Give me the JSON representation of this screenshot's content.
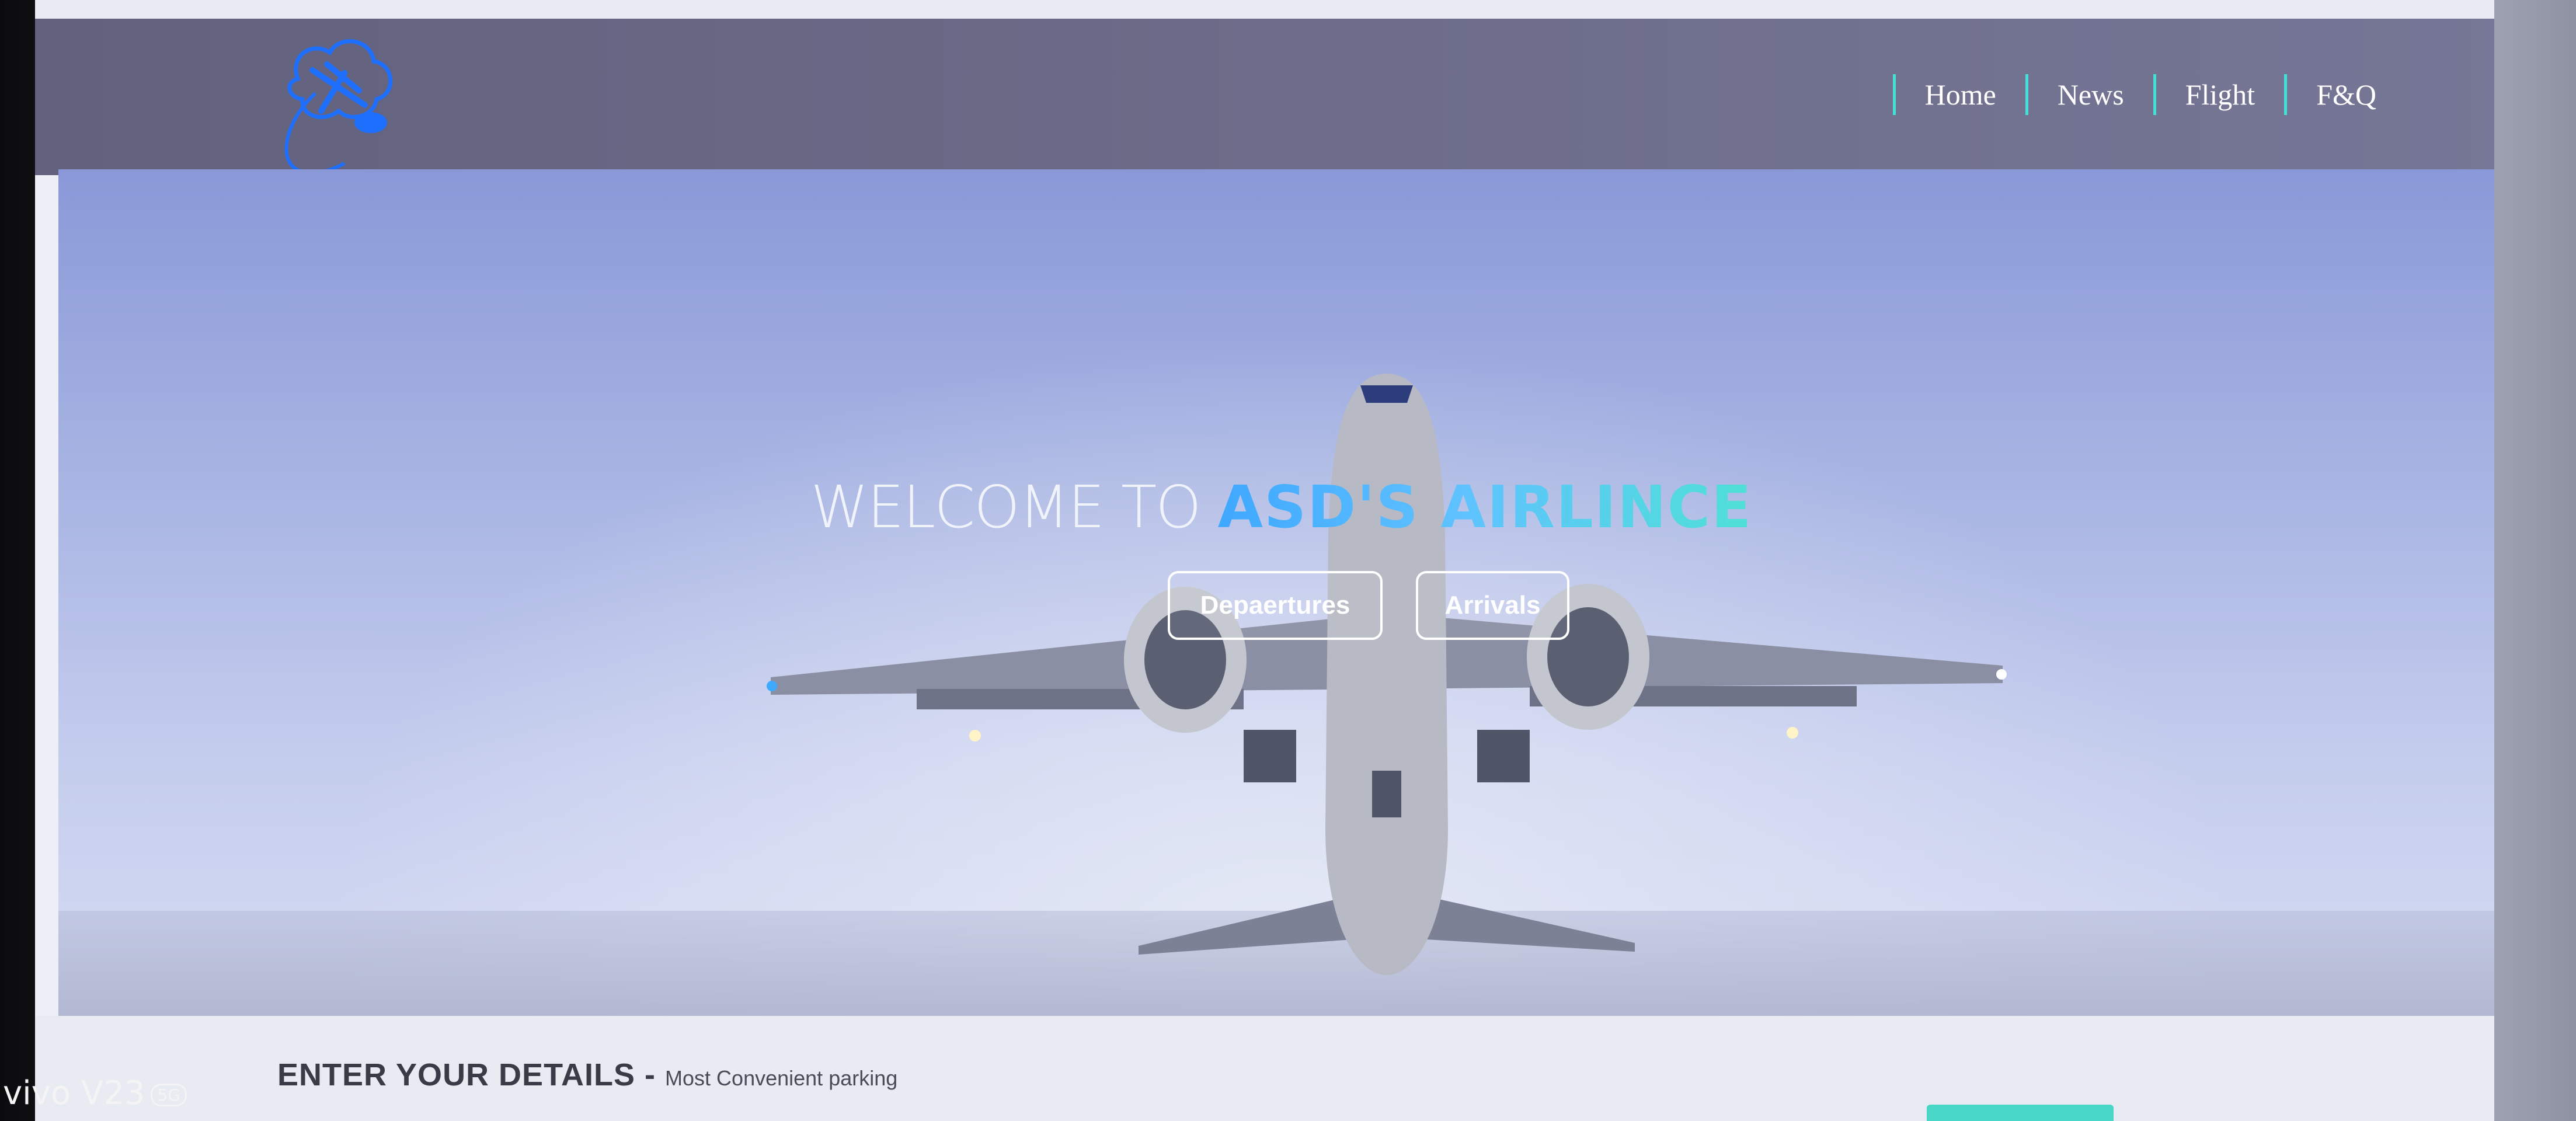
{
  "header": {
    "nav": [
      {
        "label": "Home"
      },
      {
        "label": "News"
      },
      {
        "label": "Flight"
      },
      {
        "label": "F&Q"
      }
    ]
  },
  "hero": {
    "welcome_prefix": "WELCOME TO ",
    "welcome_brand": "ASD'S AIRLINCE",
    "departures_label": "Depaertures",
    "arrivals_label": "Arrivals"
  },
  "details": {
    "heading": "ENTER YOUR DETAILS - ",
    "subheading": "Most Convenient parking"
  },
  "watermark": {
    "text": "vivo V23",
    "badge": "5G"
  },
  "colors": {
    "header_bg": "#6d6d8b",
    "nav_divider": "#43e0d8",
    "brand_blue": "#3fa8ff",
    "brand_teal": "#4fe0d6",
    "accent_button": "#48d6c6"
  },
  "icons": {
    "logo": "airplane-cloud-logo"
  }
}
